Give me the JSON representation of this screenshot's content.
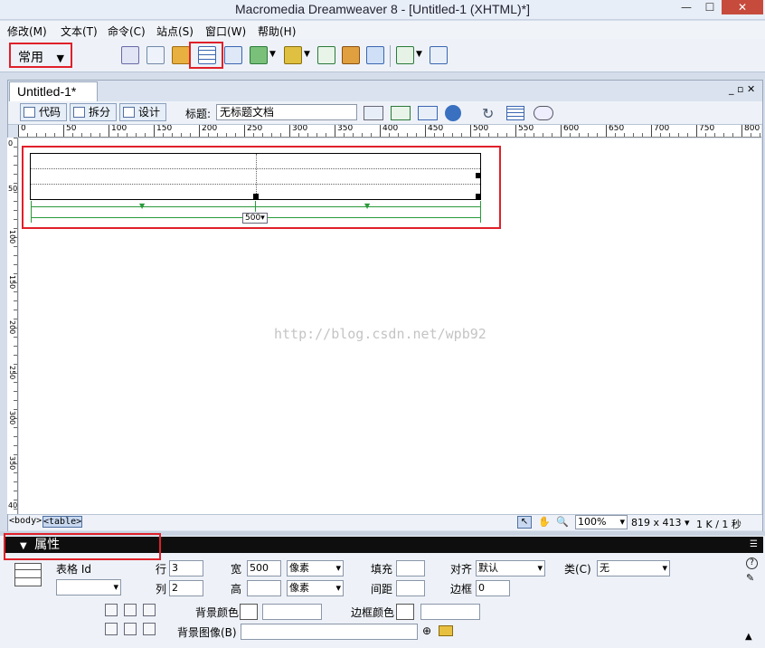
{
  "app": {
    "title": "Macromedia Dreamweaver 8 - [Untitled-1 (XHTML)*]"
  },
  "menu": [
    "修改(M)",
    "文本(T)",
    "命令(C)",
    "站点(S)",
    "窗口(W)",
    "帮助(H)"
  ],
  "toolbar": {
    "category": "常用"
  },
  "document": {
    "tab": "Untitled-1*",
    "view_buttons": [
      "代码",
      "拆分",
      "设计"
    ],
    "title_label": "标题:",
    "title_value": "无标题文档"
  },
  "ruler": {
    "h_ticks": [
      "0",
      "50",
      "100",
      "150",
      "200",
      "250",
      "300",
      "350",
      "400",
      "450",
      "500",
      "550",
      "600",
      "650",
      "700",
      "750",
      "800"
    ],
    "v_ticks": [
      "0",
      "50",
      "100",
      "150",
      "200",
      "250",
      "300",
      "350",
      "400"
    ]
  },
  "canvas": {
    "table_width_label": "500",
    "watermark": "http://blog.csdn.net/wpb92"
  },
  "status": {
    "tags": [
      "<body>",
      "<table>"
    ],
    "zoom": "100%",
    "size": "819 x 413",
    "download": "1 K / 1 秒"
  },
  "properties": {
    "header": "属性",
    "table_id_label": "表格 Id",
    "rows_label": "行",
    "rows": "3",
    "cols_label": "列",
    "cols": "2",
    "width_label": "宽",
    "width": "500",
    "width_unit": "像素",
    "height_label": "高",
    "height": "",
    "height_unit": "像素",
    "padding_label": "填充",
    "padding": "",
    "spacing_label": "间距",
    "spacing": "",
    "align_label": "对齐",
    "align": "默认",
    "border_label": "边框",
    "border": "0",
    "class_label": "类(C)",
    "class": "无",
    "bgcolor_label": "背景颜色",
    "bordercolor_label": "边框颜色",
    "bgimage_label": "背景图像(B)"
  },
  "colors": {
    "highlight": "#e0202a",
    "guide": "#2a9a3a"
  }
}
